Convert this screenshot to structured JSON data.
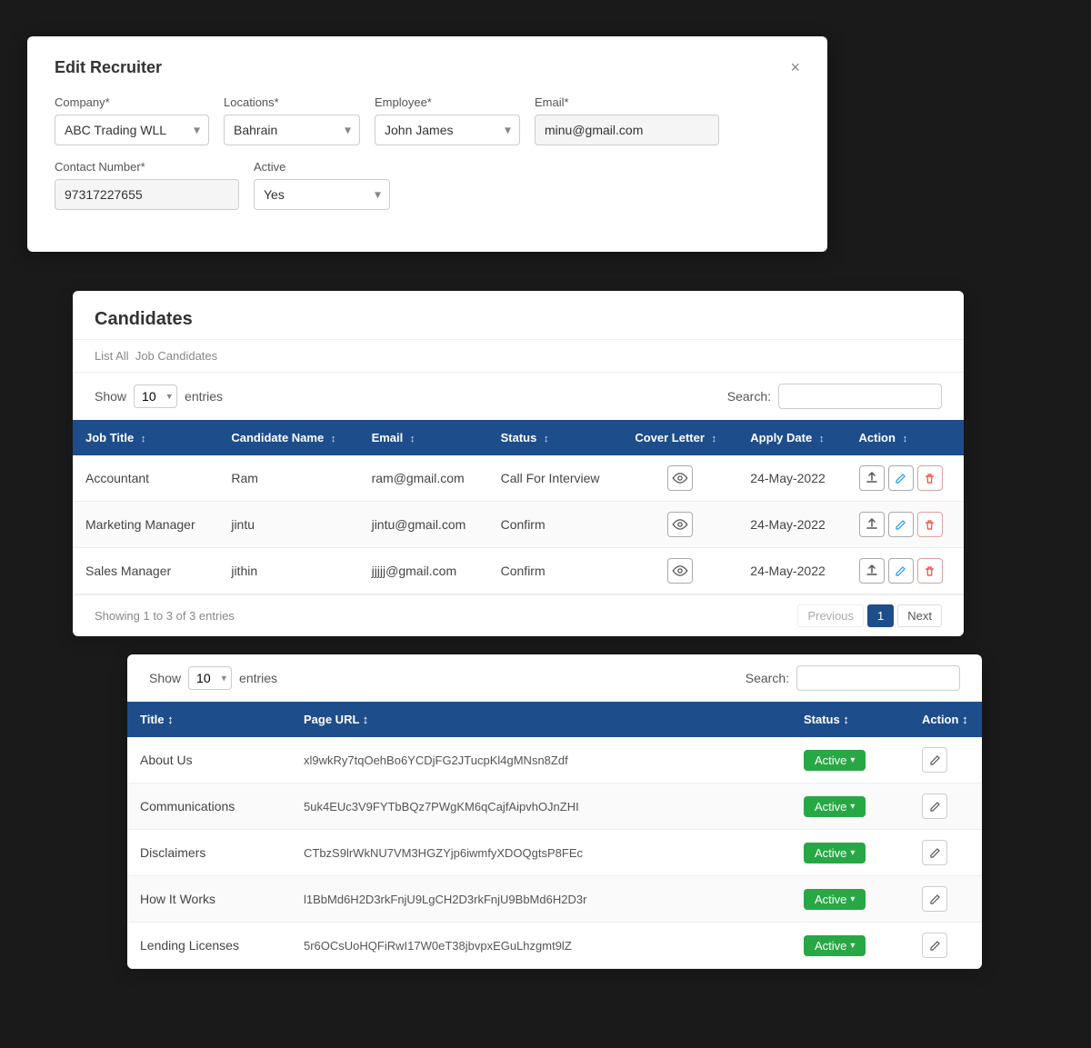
{
  "modal": {
    "title": "Edit Recruiter",
    "close_label": "×",
    "fields": {
      "company_label": "Company*",
      "company_value": "ABC Trading WLL",
      "locations_label": "Locations*",
      "locations_value": "Bahrain",
      "employee_label": "Employee*",
      "employee_value": "John James",
      "email_label": "Email*",
      "email_value": "minu@gmail.com",
      "contact_label": "Contact Number*",
      "contact_value": "97317227655",
      "active_label": "Active",
      "active_value": "Yes"
    }
  },
  "candidates_panel": {
    "title": "Candidates",
    "subtitle_prefix": "List All",
    "subtitle_suffix": "Job Candidates",
    "show_label": "Show",
    "show_value": "10",
    "entries_label": "entries",
    "search_label": "Search:",
    "columns": [
      "Job Title",
      "Candidate Name",
      "Email",
      "Status",
      "Cover Letter",
      "Apply Date",
      "Action"
    ],
    "rows": [
      {
        "job_title": "Accountant",
        "candidate_name": "Ram",
        "email": "ram@gmail.com",
        "status": "Call For Interview",
        "apply_date": "24-May-2022"
      },
      {
        "job_title": "Marketing Manager",
        "candidate_name": "jintu",
        "email": "jintu@gmail.com",
        "status": "Confirm",
        "apply_date": "24-May-2022"
      },
      {
        "job_title": "Sales Manager",
        "candidate_name": "jithin",
        "email": "jjjjj@gmail.com",
        "status": "Confirm",
        "apply_date": "24-May-2022"
      }
    ],
    "footer_text": "Showing 1 to 3 of 3 entries",
    "prev_label": "Previous",
    "page_num": "1",
    "next_label": "Next"
  },
  "pages_panel": {
    "show_label": "Show",
    "show_value": "10",
    "entries_label": "entries",
    "search_label": "Search:",
    "columns": [
      "Title",
      "Page URL",
      "Status",
      "Action"
    ],
    "rows": [
      {
        "title": "About Us",
        "page_url": "xl9wkRy7tqOehBo6YCDjFG2JTucpKl4gMNsn8Zdf",
        "status": "Active"
      },
      {
        "title": "Communications",
        "page_url": "5uk4EUc3V9FYTbBQz7PWgKM6qCajfAipvhOJnZHI",
        "status": "Active"
      },
      {
        "title": "Disclaimers",
        "page_url": "CTbzS9lrWkNU7VM3HGZYjp6iwmfyXDOQgtsP8FEc",
        "status": "Active"
      },
      {
        "title": "How It Works",
        "page_url": "l1BbMd6H2D3rkFnjU9LgCH2D3rkFnjU9BbMd6H2D3r",
        "status": "Active"
      },
      {
        "title": "Lending Licenses",
        "page_url": "5r6OCsUoHQFiRwI17W0eT38jbvpxEGuLhzgmt9lZ",
        "status": "Active"
      }
    ]
  }
}
